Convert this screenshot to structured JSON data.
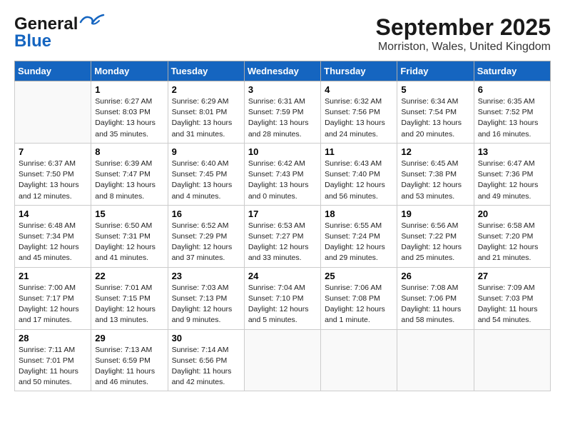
{
  "header": {
    "logo_general": "General",
    "logo_blue": "Blue",
    "month_title": "September 2025",
    "location": "Morriston, Wales, United Kingdom"
  },
  "weekdays": [
    "Sunday",
    "Monday",
    "Tuesday",
    "Wednesday",
    "Thursday",
    "Friday",
    "Saturday"
  ],
  "weeks": [
    [
      {
        "day": "",
        "sunrise": "",
        "sunset": "",
        "daylight": "",
        "empty": true
      },
      {
        "day": "1",
        "sunrise": "Sunrise: 6:27 AM",
        "sunset": "Sunset: 8:03 PM",
        "daylight": "Daylight: 13 hours and 35 minutes."
      },
      {
        "day": "2",
        "sunrise": "Sunrise: 6:29 AM",
        "sunset": "Sunset: 8:01 PM",
        "daylight": "Daylight: 13 hours and 31 minutes."
      },
      {
        "day": "3",
        "sunrise": "Sunrise: 6:31 AM",
        "sunset": "Sunset: 7:59 PM",
        "daylight": "Daylight: 13 hours and 28 minutes."
      },
      {
        "day": "4",
        "sunrise": "Sunrise: 6:32 AM",
        "sunset": "Sunset: 7:56 PM",
        "daylight": "Daylight: 13 hours and 24 minutes."
      },
      {
        "day": "5",
        "sunrise": "Sunrise: 6:34 AM",
        "sunset": "Sunset: 7:54 PM",
        "daylight": "Daylight: 13 hours and 20 minutes."
      },
      {
        "day": "6",
        "sunrise": "Sunrise: 6:35 AM",
        "sunset": "Sunset: 7:52 PM",
        "daylight": "Daylight: 13 hours and 16 minutes."
      }
    ],
    [
      {
        "day": "7",
        "sunrise": "Sunrise: 6:37 AM",
        "sunset": "Sunset: 7:50 PM",
        "daylight": "Daylight: 13 hours and 12 minutes."
      },
      {
        "day": "8",
        "sunrise": "Sunrise: 6:39 AM",
        "sunset": "Sunset: 7:47 PM",
        "daylight": "Daylight: 13 hours and 8 minutes."
      },
      {
        "day": "9",
        "sunrise": "Sunrise: 6:40 AM",
        "sunset": "Sunset: 7:45 PM",
        "daylight": "Daylight: 13 hours and 4 minutes."
      },
      {
        "day": "10",
        "sunrise": "Sunrise: 6:42 AM",
        "sunset": "Sunset: 7:43 PM",
        "daylight": "Daylight: 13 hours and 0 minutes."
      },
      {
        "day": "11",
        "sunrise": "Sunrise: 6:43 AM",
        "sunset": "Sunset: 7:40 PM",
        "daylight": "Daylight: 12 hours and 56 minutes."
      },
      {
        "day": "12",
        "sunrise": "Sunrise: 6:45 AM",
        "sunset": "Sunset: 7:38 PM",
        "daylight": "Daylight: 12 hours and 53 minutes."
      },
      {
        "day": "13",
        "sunrise": "Sunrise: 6:47 AM",
        "sunset": "Sunset: 7:36 PM",
        "daylight": "Daylight: 12 hours and 49 minutes."
      }
    ],
    [
      {
        "day": "14",
        "sunrise": "Sunrise: 6:48 AM",
        "sunset": "Sunset: 7:34 PM",
        "daylight": "Daylight: 12 hours and 45 minutes."
      },
      {
        "day": "15",
        "sunrise": "Sunrise: 6:50 AM",
        "sunset": "Sunset: 7:31 PM",
        "daylight": "Daylight: 12 hours and 41 minutes."
      },
      {
        "day": "16",
        "sunrise": "Sunrise: 6:52 AM",
        "sunset": "Sunset: 7:29 PM",
        "daylight": "Daylight: 12 hours and 37 minutes."
      },
      {
        "day": "17",
        "sunrise": "Sunrise: 6:53 AM",
        "sunset": "Sunset: 7:27 PM",
        "daylight": "Daylight: 12 hours and 33 minutes."
      },
      {
        "day": "18",
        "sunrise": "Sunrise: 6:55 AM",
        "sunset": "Sunset: 7:24 PM",
        "daylight": "Daylight: 12 hours and 29 minutes."
      },
      {
        "day": "19",
        "sunrise": "Sunrise: 6:56 AM",
        "sunset": "Sunset: 7:22 PM",
        "daylight": "Daylight: 12 hours and 25 minutes."
      },
      {
        "day": "20",
        "sunrise": "Sunrise: 6:58 AM",
        "sunset": "Sunset: 7:20 PM",
        "daylight": "Daylight: 12 hours and 21 minutes."
      }
    ],
    [
      {
        "day": "21",
        "sunrise": "Sunrise: 7:00 AM",
        "sunset": "Sunset: 7:17 PM",
        "daylight": "Daylight: 12 hours and 17 minutes."
      },
      {
        "day": "22",
        "sunrise": "Sunrise: 7:01 AM",
        "sunset": "Sunset: 7:15 PM",
        "daylight": "Daylight: 12 hours and 13 minutes."
      },
      {
        "day": "23",
        "sunrise": "Sunrise: 7:03 AM",
        "sunset": "Sunset: 7:13 PM",
        "daylight": "Daylight: 12 hours and 9 minutes."
      },
      {
        "day": "24",
        "sunrise": "Sunrise: 7:04 AM",
        "sunset": "Sunset: 7:10 PM",
        "daylight": "Daylight: 12 hours and 5 minutes."
      },
      {
        "day": "25",
        "sunrise": "Sunrise: 7:06 AM",
        "sunset": "Sunset: 7:08 PM",
        "daylight": "Daylight: 12 hours and 1 minute."
      },
      {
        "day": "26",
        "sunrise": "Sunrise: 7:08 AM",
        "sunset": "Sunset: 7:06 PM",
        "daylight": "Daylight: 11 hours and 58 minutes."
      },
      {
        "day": "27",
        "sunrise": "Sunrise: 7:09 AM",
        "sunset": "Sunset: 7:03 PM",
        "daylight": "Daylight: 11 hours and 54 minutes."
      }
    ],
    [
      {
        "day": "28",
        "sunrise": "Sunrise: 7:11 AM",
        "sunset": "Sunset: 7:01 PM",
        "daylight": "Daylight: 11 hours and 50 minutes."
      },
      {
        "day": "29",
        "sunrise": "Sunrise: 7:13 AM",
        "sunset": "Sunset: 6:59 PM",
        "daylight": "Daylight: 11 hours and 46 minutes."
      },
      {
        "day": "30",
        "sunrise": "Sunrise: 7:14 AM",
        "sunset": "Sunset: 6:56 PM",
        "daylight": "Daylight: 11 hours and 42 minutes."
      },
      {
        "day": "",
        "sunrise": "",
        "sunset": "",
        "daylight": "",
        "empty": true
      },
      {
        "day": "",
        "sunrise": "",
        "sunset": "",
        "daylight": "",
        "empty": true
      },
      {
        "day": "",
        "sunrise": "",
        "sunset": "",
        "daylight": "",
        "empty": true
      },
      {
        "day": "",
        "sunrise": "",
        "sunset": "",
        "daylight": "",
        "empty": true
      }
    ]
  ]
}
